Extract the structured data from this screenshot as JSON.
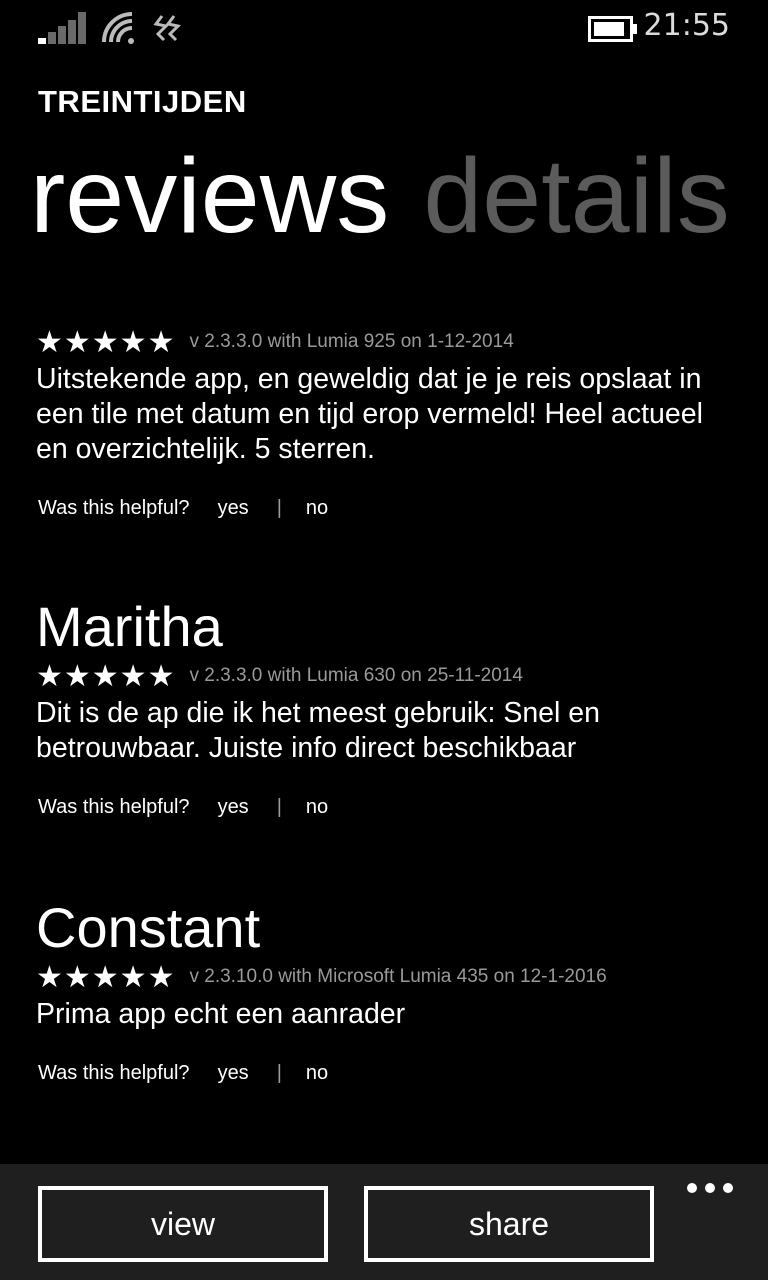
{
  "status_bar": {
    "time": "21:55",
    "icons": [
      "signal-icon",
      "wifi-icon",
      "data-sense-icon",
      "battery-icon"
    ]
  },
  "header": {
    "app_title": "TREINTIJDEN",
    "pivot": {
      "active": "reviews",
      "inactive": "details"
    }
  },
  "reviews": {
    "helpful_question": "Was this helpful?",
    "yes_label": "yes",
    "separator": "|",
    "no_label": "no",
    "items": [
      {
        "name": "",
        "stars": "★★★★★",
        "rating": 5,
        "meta": "v 2.3.3.0 with Lumia 925 on 1-12-2014",
        "text": "Uitstekende app, en geweldig dat je je reis opslaat in een tile met datum en tijd erop vermeld! Heel actueel en overzichtelijk. 5 sterren."
      },
      {
        "name": "Maritha",
        "stars": "★★★★★",
        "rating": 5,
        "meta": "v 2.3.3.0 with Lumia 630 on 25-11-2014",
        "text": "Dit is de ap die ik het meest gebruik: Snel en betrouwbaar. Juiste info direct beschikbaar"
      },
      {
        "name": "Constant",
        "stars": "★★★★★",
        "rating": 5,
        "meta": "v 2.3.10.0 with Microsoft Lumia 435 on 12-1-2016",
        "text": "Prima app echt een aanrader"
      }
    ]
  },
  "app_bar": {
    "view_label": "view",
    "share_label": "share",
    "more_icon": "more-dots-icon"
  }
}
